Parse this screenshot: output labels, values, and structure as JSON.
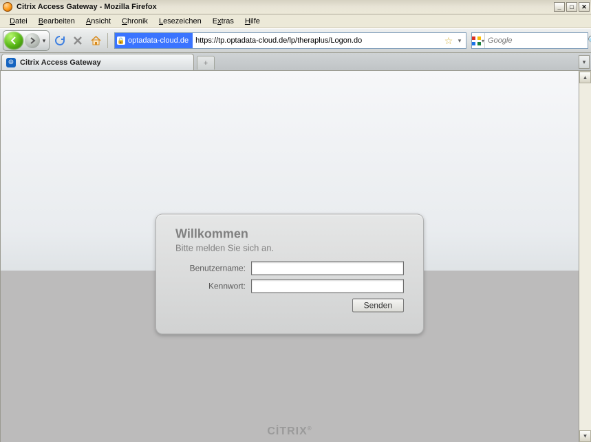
{
  "window": {
    "title": "Citrix Access Gateway - Mozilla Firefox"
  },
  "menu": {
    "datei": "Datei",
    "bearbeiten": "Bearbeiten",
    "ansicht": "Ansicht",
    "chronik": "Chronik",
    "lesezeichen": "Lesezeichen",
    "extras": "Extras",
    "hilfe": "Hilfe"
  },
  "urlbar": {
    "badge": "optadata-cloud.de",
    "url": "https://tp.optadata-cloud.de/lp/theraplus/Logon.do"
  },
  "search": {
    "placeholder": "Google"
  },
  "tab": {
    "label": "Citrix Access Gateway"
  },
  "login": {
    "heading": "Willkommen",
    "subheading": "Bitte melden Sie sich an.",
    "username_label": "Benutzername:",
    "password_label": "Kennwort:",
    "username_value": "",
    "password_value": "",
    "submit_label": "Senden"
  },
  "footer": {
    "brand": "CİTRIX"
  }
}
